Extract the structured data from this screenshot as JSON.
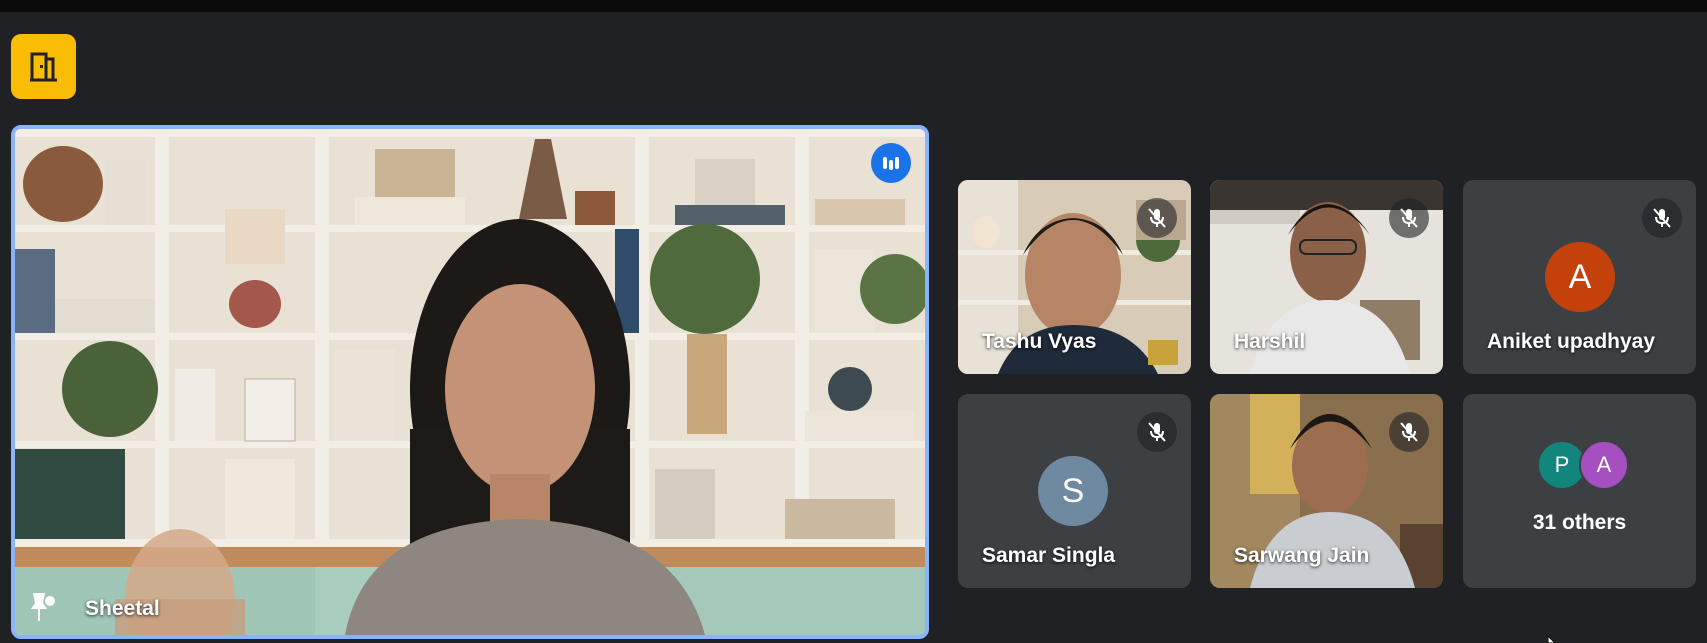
{
  "top": {
    "exit_icon": "door-exit-icon"
  },
  "speaker": {
    "name": "Sheetal",
    "speaking_icon": "audio-level-icon",
    "pin_icon": "pin-icon"
  },
  "participants": [
    {
      "name": "Tashu Vyas",
      "muted": true
    },
    {
      "name": "Harshil",
      "muted": true
    },
    {
      "name": "Aniket upadhyay",
      "avatar_letter": "A",
      "avatar_color": "#c5410c",
      "muted": true
    },
    {
      "name": "Samar Singla",
      "avatar_letter": "S",
      "avatar_color": "#6f8aa0",
      "muted": true
    },
    {
      "name": "Sarwang Jain",
      "muted": true
    }
  ],
  "others": {
    "label": "31 others",
    "avatars": [
      {
        "letter": "P",
        "color": "#12867c"
      },
      {
        "letter": "A",
        "color": "#a54fc0"
      }
    ]
  },
  "colors": {
    "accent": "#8ab4f8",
    "exit_button": "#fbbc04",
    "tile_bg": "#3c4043",
    "background": "#202124"
  }
}
